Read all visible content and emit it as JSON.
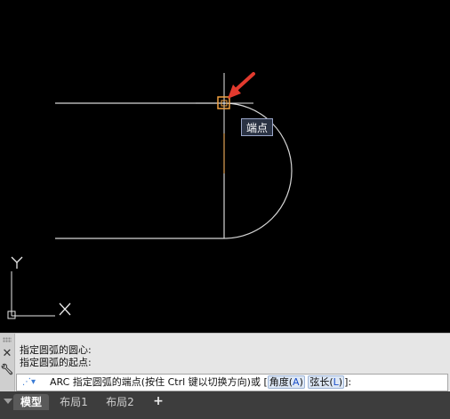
{
  "tooltip": {
    "label": "端点"
  },
  "ucs": {
    "y_label": "Y",
    "x_label": "X"
  },
  "command": {
    "history": [
      "指定圆弧的圆心:",
      "指定圆弧的起点:"
    ],
    "prompt_prefix": "ARC 指定圆弧的端点(按住 Ctrl 键以切换方向)或 [",
    "option1_text": "角度(",
    "option1_key": "A",
    "option1_close": ")",
    "option2_text": "弦长(",
    "option2_key": "L",
    "option2_close": ")",
    "prompt_suffix": "]:"
  },
  "tabs": [
    {
      "label": "模型",
      "active": true
    },
    {
      "label": "布局1",
      "active": false
    },
    {
      "label": "布局2",
      "active": false
    }
  ],
  "tab_add_label": "+",
  "colors": {
    "background": "#000000",
    "geometry": "#d0d0d0",
    "snap_marker": "#f0a040",
    "arrow": "#e23a2e",
    "tooltip_bg": "#2a3243"
  }
}
